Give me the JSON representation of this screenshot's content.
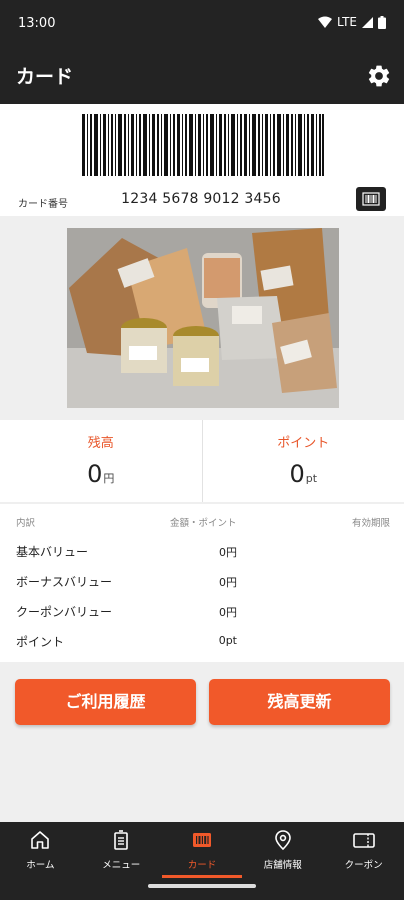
{
  "status": {
    "time": "13:00",
    "network": "LTE"
  },
  "header": {
    "title": "カード",
    "settings_icon": "gear-icon"
  },
  "card": {
    "label": "カード番号",
    "number": "1234 5678 9012 3456",
    "barcode_button_icon": "barcode-icon"
  },
  "photo": {
    "subject": "product-photo"
  },
  "balance": {
    "balance_label": "残高",
    "balance_value": "0",
    "balance_unit": "円",
    "points_label": "ポイント",
    "points_value": "0",
    "points_unit": "pt"
  },
  "breakdown": {
    "headers": {
      "detail": "内訳",
      "amount": "金額・ポイント",
      "expiry": "有効期限"
    },
    "rows": [
      {
        "label": "基本バリュー",
        "value": "0円"
      },
      {
        "label": "ボーナスバリュー",
        "value": "0円"
      },
      {
        "label": "クーポンバリュー",
        "value": "0円"
      },
      {
        "label": "ポイント",
        "value": "0pt"
      }
    ]
  },
  "actions": {
    "history": "ご利用履歴",
    "refresh": "残高更新"
  },
  "nav": [
    {
      "label": "ホーム",
      "icon": "home-icon"
    },
    {
      "label": "メニュー",
      "icon": "menu-icon"
    },
    {
      "label": "カード",
      "icon": "card-icon",
      "active": true
    },
    {
      "label": "店舗情報",
      "icon": "location-icon"
    },
    {
      "label": "クーポン",
      "icon": "coupon-icon"
    }
  ],
  "colors": {
    "accent": "#f1592a",
    "dark": "#232323"
  }
}
